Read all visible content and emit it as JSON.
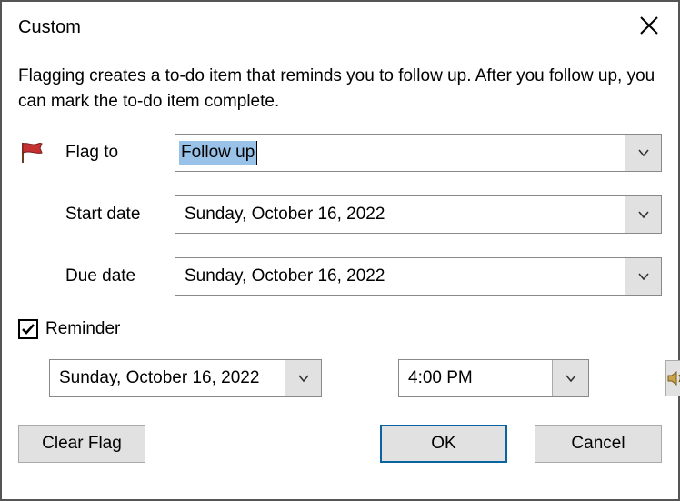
{
  "title": "Custom",
  "description": "Flagging creates a to-do item that reminds you to follow up. After you follow up, you can mark the to-do item complete.",
  "labels": {
    "flag_to": "Flag to",
    "start_date": "Start date",
    "due_date": "Due date",
    "reminder": "Reminder"
  },
  "fields": {
    "flag_to_value": "Follow up",
    "start_date_value": "Sunday, October 16, 2022",
    "due_date_value": "Sunday, October 16, 2022",
    "reminder_checked": true,
    "reminder_date": "Sunday, October 16, 2022",
    "reminder_time": "4:00 PM"
  },
  "buttons": {
    "clear_flag": "Clear Flag",
    "ok": "OK",
    "cancel": "Cancel"
  }
}
